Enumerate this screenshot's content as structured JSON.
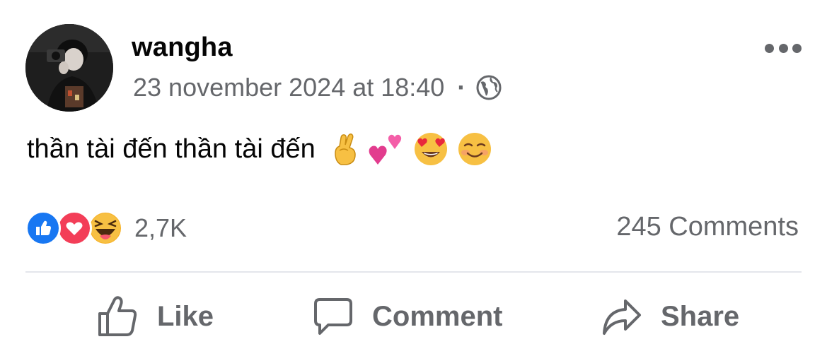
{
  "post": {
    "author": "wangha",
    "timestamp": "23 november 2024 at 18:40",
    "separator": "·",
    "audience_icon": "globe-icon",
    "more_icon": "more-horizontal-icon",
    "text": "thần tài đến thần tài đến",
    "emojis": [
      "pinched-fingers-emoji",
      "two-hearts-emoji",
      "heart-eyes-emoji",
      "smiling-blush-emoji"
    ]
  },
  "engagement": {
    "reactions": [
      "like",
      "love",
      "haha"
    ],
    "reaction_count": "2,7K",
    "comments": "245 Comments"
  },
  "actions": {
    "like_label": "Like",
    "comment_label": "Comment",
    "share_label": "Share"
  },
  "colors": {
    "text_primary": "#050505",
    "text_secondary": "#65676b",
    "like_blue": "#1877f2",
    "love_red": "#f33e58",
    "haha_yellow": "#f7b125",
    "divider": "#e4e6eb"
  }
}
